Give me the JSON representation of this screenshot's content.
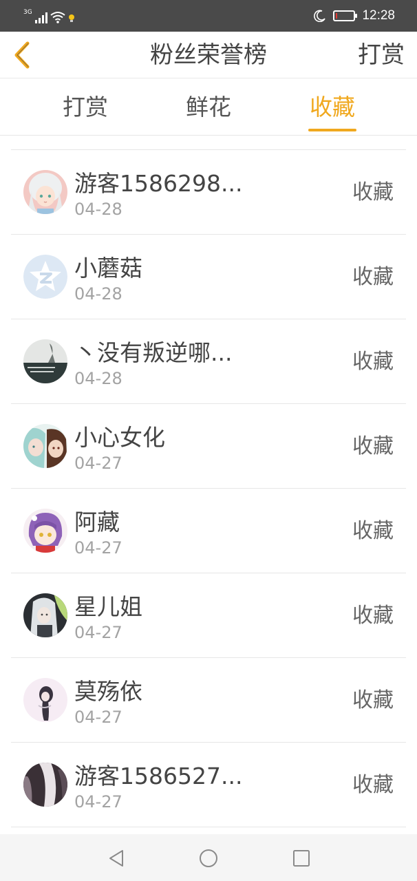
{
  "status_bar": {
    "network": "3G",
    "time": "12:28",
    "battery_level": 0.1
  },
  "header": {
    "title": "粉丝荣誉榜",
    "action_label": "打赏",
    "back_icon": "chevron-left-icon"
  },
  "tabs": [
    {
      "label": "打赏",
      "active": false
    },
    {
      "label": "鲜花",
      "active": false
    },
    {
      "label": "收藏",
      "active": true
    }
  ],
  "accent_color": "#f0a81e",
  "list": [
    {
      "name": "游客1586298...",
      "date": "04-28",
      "action": "收藏",
      "avatar": "anime-avatar-white-hair"
    },
    {
      "name": "小蘑菇",
      "date": "04-28",
      "action": "收藏",
      "avatar": "qq-default-avatar"
    },
    {
      "name": "丶没有叛逆哪...",
      "date": "04-28",
      "action": "收藏",
      "avatar": "photo-avatar-text"
    },
    {
      "name": "小心女化",
      "date": "04-27",
      "action": "收藏",
      "avatar": "anime-avatar-pair"
    },
    {
      "name": "阿藏",
      "date": "04-27",
      "action": "收藏",
      "avatar": "anime-avatar-purple-hair"
    },
    {
      "name": "星儿姐",
      "date": "04-27",
      "action": "收藏",
      "avatar": "anime-avatar-silver-hair"
    },
    {
      "name": "莫殇依",
      "date": "04-27",
      "action": "收藏",
      "avatar": "drawing-avatar-girl"
    },
    {
      "name": "游客1586527...",
      "date": "04-27",
      "action": "收藏",
      "avatar": "photo-avatar-dark"
    }
  ],
  "nav_bar": {
    "back": "triangle-back-icon",
    "home": "circle-home-icon",
    "recents": "square-recents-icon"
  }
}
